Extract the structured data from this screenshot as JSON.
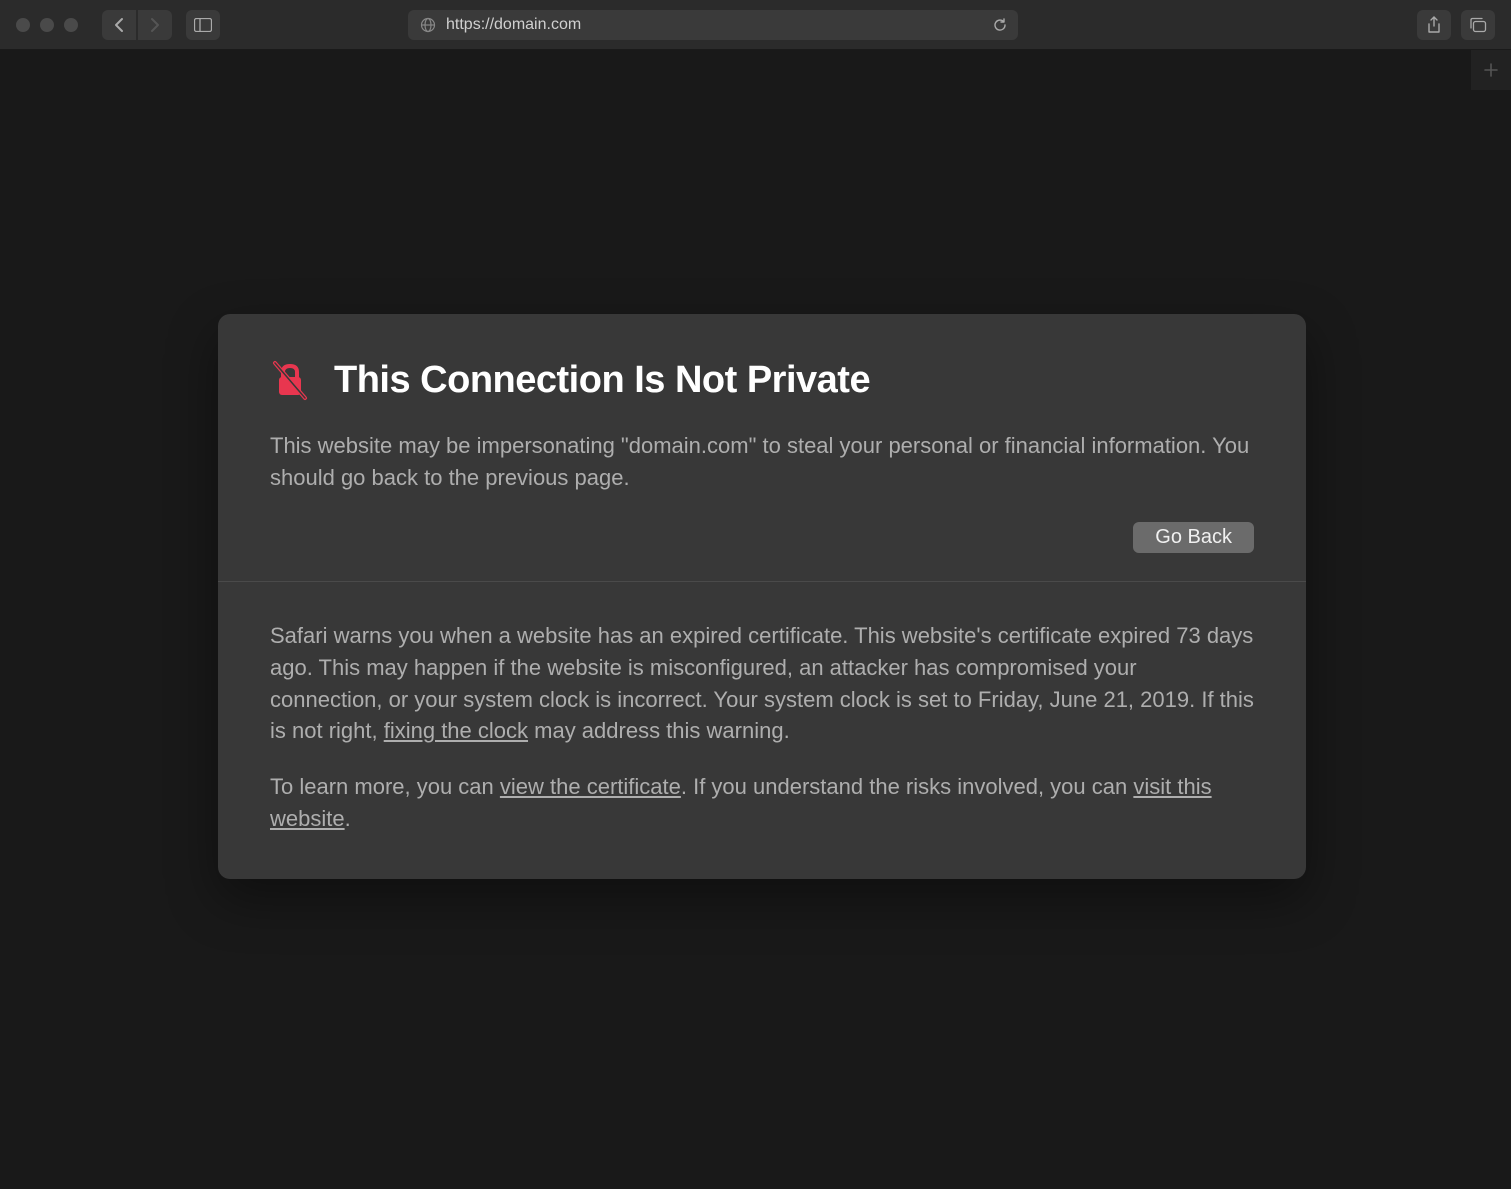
{
  "toolbar": {
    "url": "https://domain.com"
  },
  "warning": {
    "title": "This Connection Is Not Private",
    "body": "This website may be impersonating \"domain.com\" to steal your personal or financial information. You should go back to the previous page.",
    "go_back_label": "Go Back",
    "detail_pre": "Safari warns you when a website has an expired certificate. This website's certificate expired 73 days ago. This may happen if the website is misconfigured, an attacker has compromised your connection, or your system clock is incorrect. Your system clock is set to Friday, June 21, 2019. If this is not right, ",
    "fixing_clock": "fixing the clock",
    "detail_post": " may address this warning.",
    "learn_pre": "To learn more, you can ",
    "view_cert": "view the certificate",
    "learn_mid": ". If you understand the risks involved, you can ",
    "visit_site": "visit this website",
    "learn_post": "."
  }
}
